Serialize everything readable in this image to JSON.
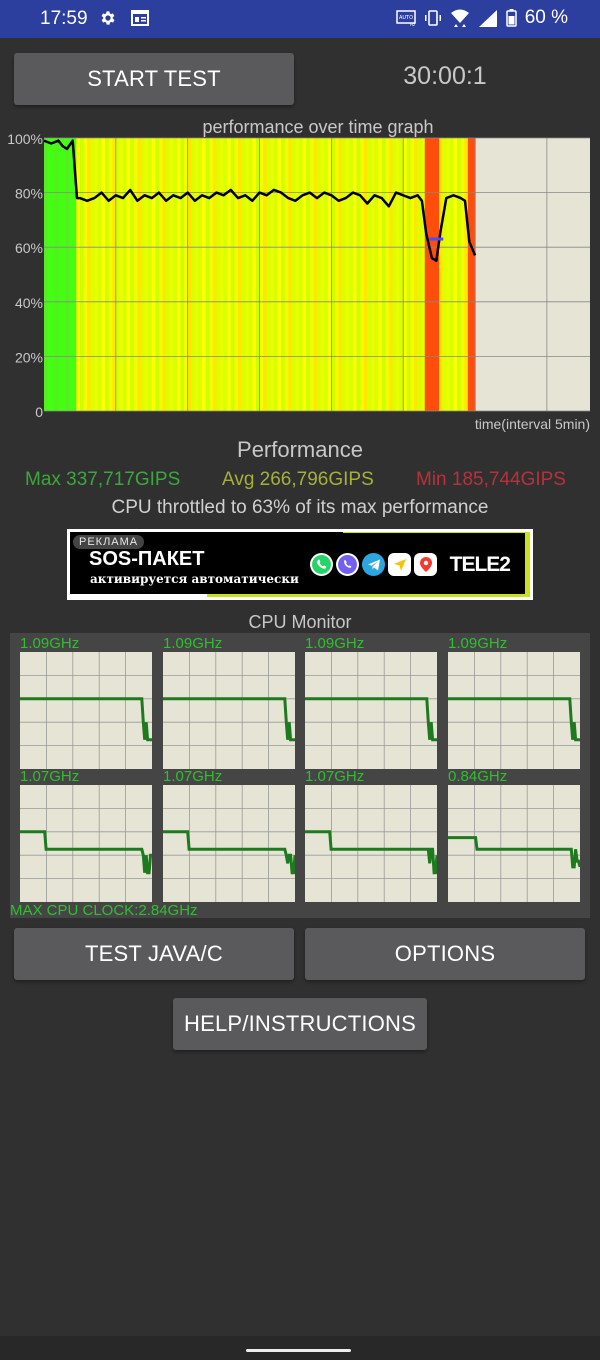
{
  "status_bar": {
    "time": "17:59",
    "battery_text": "60 %",
    "left_icons": [
      "gear-icon",
      "calendar-icon"
    ],
    "right_icons": [
      "auto-hz-icon",
      "vibrate-icon",
      "wifi-icon",
      "signal-icon",
      "battery-icon"
    ]
  },
  "controls": {
    "start_label": "START TEST",
    "timer": "30:00:1"
  },
  "chart_title": "performance over time graph",
  "chart_data": {
    "type": "area",
    "title": "performance over time graph",
    "xlabel": "time(interval 5min)",
    "ylabel": "",
    "ytick_labels": [
      "0",
      "20%",
      "40%",
      "60%",
      "80%",
      "100%"
    ],
    "yticks": [
      0,
      20,
      40,
      60,
      80,
      100
    ],
    "ylim": [
      0,
      100
    ],
    "xlim": [
      0,
      38
    ],
    "x_grid_interval": 5,
    "grid": true,
    "x": [
      0,
      0.5,
      1,
      1.3,
      1.6,
      2.0,
      2.3,
      2.5,
      3.0,
      3.5,
      4.0,
      4.5,
      5.0,
      5.5,
      6.0,
      6.5,
      7.0,
      7.5,
      8.0,
      8.5,
      9.0,
      9.5,
      10.0,
      10.5,
      11.0,
      11.5,
      12.0,
      12.5,
      13.0,
      13.5,
      14.0,
      14.5,
      15.0,
      15.5,
      16.0,
      16.5,
      17.0,
      17.5,
      18.0,
      18.5,
      19.0,
      19.5,
      20.0,
      20.5,
      21.0,
      21.5,
      22.0,
      22.5,
      23.0,
      23.5,
      24.0,
      24.5,
      25.0,
      25.5,
      26.0,
      26.3,
      26.6,
      27.0,
      27.3,
      27.6,
      28.0,
      28.5,
      29.0,
      29.3,
      29.6,
      30.0
    ],
    "values": [
      99,
      98,
      99,
      97,
      96,
      99,
      78,
      78,
      77,
      78,
      80,
      77,
      79,
      78,
      81,
      77,
      79,
      78,
      80,
      77,
      79,
      78,
      80,
      77,
      79,
      78,
      80,
      79,
      81,
      78,
      79,
      77,
      80,
      79,
      81,
      80,
      78,
      77,
      79,
      80,
      78,
      80,
      79,
      77,
      78,
      80,
      79,
      76,
      79,
      78,
      75,
      80,
      79,
      78,
      79,
      77,
      65,
      56,
      55,
      66,
      78,
      79,
      78,
      77,
      62,
      57
    ],
    "bar_colors": "green before throttle, yellow/lime while throttled, red-orange where performance dropped sharply",
    "markers": [
      {
        "x": 27.3,
        "y": 63,
        "color": "#4a4aff",
        "label": "throttle line"
      }
    ]
  },
  "performance": {
    "heading": "Performance",
    "max": "Max 337,717GIPS",
    "avg": "Avg 266,796GIPS",
    "min": "Min 185,744GIPS",
    "throttle_text": "CPU throttled to 63% of its max performance",
    "colors": {
      "max": "#3aa83a",
      "avg": "#a4b03a",
      "min": "#b8303c"
    }
  },
  "ad": {
    "label": "РЕКЛАМА",
    "title": "SOS-ПАКЕТ",
    "subtitle": "активируется автоматически",
    "brand": "TELE2",
    "app_icons": [
      "whatsapp-icon",
      "viber-icon",
      "telegram-icon",
      "navigator-icon",
      "maps-pin-icon"
    ],
    "accent": "#c6e31b"
  },
  "cpu_monitor": {
    "title": "CPU Monitor",
    "cores": [
      {
        "freq": "1.09GHz",
        "trace": [
          0.6,
          0.6,
          0.6,
          0.6,
          0.6,
          0.6,
          0.6,
          0.6,
          0.6,
          0.6,
          0.6,
          0.6,
          0.6,
          0.6,
          0.6,
          0.6,
          0.6,
          0.6,
          0.6,
          0.6,
          0.6,
          0.6,
          0.6,
          0.6,
          0.6,
          0.6,
          0.6,
          0.6,
          0.6,
          0.6,
          0.6,
          0.6,
          0.6,
          0.6,
          0.6,
          0.6,
          0.6,
          0.6,
          0.6,
          0.6,
          0.6,
          0.6,
          0.6,
          0.6,
          0.6,
          0.6,
          0.6,
          0.6,
          0.6,
          0.6,
          0.6,
          0.6,
          0.6,
          0.6,
          0.6,
          0.6,
          0.6,
          0.6,
          0.6,
          0.6,
          0.6,
          0.6,
          0.6,
          0.6,
          0.6,
          0.6,
          0.6,
          0.6,
          0.6,
          0.6,
          0.6,
          0.6,
          0.6,
          0.6,
          0.6,
          0.6,
          0.6,
          0.6,
          0.6,
          0.6,
          0.6,
          0.6,
          0.6,
          0.6,
          0.6,
          0.4,
          0.25,
          0.4,
          0.25,
          0.25,
          0.25,
          0.25
        ]
      },
      {
        "freq": "1.09GHz",
        "trace": [
          0.6,
          0.6,
          0.6,
          0.6,
          0.6,
          0.6,
          0.6,
          0.6,
          0.6,
          0.6,
          0.6,
          0.6,
          0.6,
          0.6,
          0.6,
          0.6,
          0.6,
          0.6,
          0.6,
          0.6,
          0.6,
          0.6,
          0.6,
          0.6,
          0.6,
          0.6,
          0.6,
          0.6,
          0.6,
          0.6,
          0.6,
          0.6,
          0.6,
          0.6,
          0.6,
          0.6,
          0.6,
          0.6,
          0.6,
          0.6,
          0.6,
          0.6,
          0.6,
          0.6,
          0.6,
          0.6,
          0.6,
          0.6,
          0.6,
          0.6,
          0.6,
          0.6,
          0.6,
          0.6,
          0.6,
          0.6,
          0.6,
          0.6,
          0.6,
          0.6,
          0.6,
          0.6,
          0.6,
          0.6,
          0.6,
          0.6,
          0.6,
          0.6,
          0.6,
          0.6,
          0.6,
          0.6,
          0.6,
          0.6,
          0.6,
          0.6,
          0.6,
          0.6,
          0.6,
          0.6,
          0.6,
          0.6,
          0.6,
          0.6,
          0.6,
          0.4,
          0.25,
          0.4,
          0.25,
          0.25,
          0.25,
          0.25
        ]
      },
      {
        "freq": "1.09GHz",
        "trace": [
          0.6,
          0.6,
          0.6,
          0.6,
          0.6,
          0.6,
          0.6,
          0.6,
          0.6,
          0.6,
          0.6,
          0.6,
          0.6,
          0.6,
          0.6,
          0.6,
          0.6,
          0.6,
          0.6,
          0.6,
          0.6,
          0.6,
          0.6,
          0.6,
          0.6,
          0.6,
          0.6,
          0.6,
          0.6,
          0.6,
          0.6,
          0.6,
          0.6,
          0.6,
          0.6,
          0.6,
          0.6,
          0.6,
          0.6,
          0.6,
          0.6,
          0.6,
          0.6,
          0.6,
          0.6,
          0.6,
          0.6,
          0.6,
          0.6,
          0.6,
          0.6,
          0.6,
          0.6,
          0.6,
          0.6,
          0.6,
          0.6,
          0.6,
          0.6,
          0.6,
          0.6,
          0.6,
          0.6,
          0.6,
          0.6,
          0.6,
          0.6,
          0.6,
          0.6,
          0.6,
          0.6,
          0.6,
          0.6,
          0.6,
          0.6,
          0.6,
          0.6,
          0.6,
          0.6,
          0.6,
          0.6,
          0.6,
          0.6,
          0.6,
          0.6,
          0.4,
          0.25,
          0.4,
          0.25,
          0.25,
          0.25,
          0.25
        ]
      },
      {
        "freq": "1.09GHz",
        "trace": [
          0.6,
          0.6,
          0.6,
          0.6,
          0.6,
          0.6,
          0.6,
          0.6,
          0.6,
          0.6,
          0.6,
          0.6,
          0.6,
          0.6,
          0.6,
          0.6,
          0.6,
          0.6,
          0.6,
          0.6,
          0.6,
          0.6,
          0.6,
          0.6,
          0.6,
          0.6,
          0.6,
          0.6,
          0.6,
          0.6,
          0.6,
          0.6,
          0.6,
          0.6,
          0.6,
          0.6,
          0.6,
          0.6,
          0.6,
          0.6,
          0.6,
          0.6,
          0.6,
          0.6,
          0.6,
          0.6,
          0.6,
          0.6,
          0.6,
          0.6,
          0.6,
          0.6,
          0.6,
          0.6,
          0.6,
          0.6,
          0.6,
          0.6,
          0.6,
          0.6,
          0.6,
          0.6,
          0.6,
          0.6,
          0.6,
          0.6,
          0.6,
          0.6,
          0.6,
          0.6,
          0.6,
          0.6,
          0.6,
          0.6,
          0.6,
          0.6,
          0.6,
          0.6,
          0.6,
          0.6,
          0.6,
          0.6,
          0.6,
          0.6,
          0.6,
          0.4,
          0.25,
          0.4,
          0.25,
          0.25,
          0.25,
          0.25
        ]
      },
      {
        "freq": "1.07GHz",
        "trace": [
          0.6,
          0.6,
          0.6,
          0.6,
          0.6,
          0.6,
          0.6,
          0.6,
          0.6,
          0.6,
          0.6,
          0.6,
          0.6,
          0.6,
          0.6,
          0.6,
          0.6,
          0.6,
          0.45,
          0.45,
          0.45,
          0.45,
          0.45,
          0.45,
          0.45,
          0.45,
          0.45,
          0.45,
          0.45,
          0.45,
          0.45,
          0.45,
          0.45,
          0.45,
          0.45,
          0.45,
          0.45,
          0.45,
          0.45,
          0.45,
          0.45,
          0.45,
          0.45,
          0.45,
          0.45,
          0.45,
          0.45,
          0.45,
          0.45,
          0.45,
          0.45,
          0.45,
          0.45,
          0.45,
          0.45,
          0.45,
          0.45,
          0.45,
          0.45,
          0.45,
          0.45,
          0.45,
          0.45,
          0.45,
          0.45,
          0.45,
          0.45,
          0.45,
          0.45,
          0.45,
          0.45,
          0.45,
          0.45,
          0.45,
          0.45,
          0.45,
          0.45,
          0.45,
          0.45,
          0.45,
          0.45,
          0.45,
          0.45,
          0.45,
          0.45,
          0.4,
          0.25,
          0.4,
          0.25,
          0.25,
          0.4,
          0.4
        ]
      },
      {
        "freq": "1.07GHz",
        "trace": [
          0.6,
          0.6,
          0.6,
          0.6,
          0.6,
          0.6,
          0.6,
          0.6,
          0.6,
          0.6,
          0.6,
          0.6,
          0.6,
          0.6,
          0.6,
          0.6,
          0.6,
          0.6,
          0.45,
          0.45,
          0.45,
          0.45,
          0.45,
          0.45,
          0.45,
          0.45,
          0.45,
          0.45,
          0.45,
          0.45,
          0.45,
          0.45,
          0.45,
          0.45,
          0.45,
          0.45,
          0.45,
          0.45,
          0.45,
          0.45,
          0.45,
          0.45,
          0.45,
          0.45,
          0.45,
          0.45,
          0.45,
          0.45,
          0.45,
          0.45,
          0.45,
          0.45,
          0.45,
          0.45,
          0.45,
          0.45,
          0.45,
          0.45,
          0.45,
          0.45,
          0.45,
          0.45,
          0.45,
          0.45,
          0.45,
          0.45,
          0.45,
          0.45,
          0.45,
          0.45,
          0.45,
          0.45,
          0.45,
          0.45,
          0.45,
          0.45,
          0.45,
          0.45,
          0.45,
          0.45,
          0.45,
          0.45,
          0.45,
          0.45,
          0.45,
          0.4,
          0.33,
          0.4,
          0.4,
          0.25,
          0.25,
          0.4
        ]
      },
      {
        "freq": "1.07GHz",
        "trace": [
          0.6,
          0.6,
          0.6,
          0.6,
          0.6,
          0.6,
          0.6,
          0.6,
          0.6,
          0.6,
          0.6,
          0.6,
          0.6,
          0.6,
          0.6,
          0.6,
          0.6,
          0.6,
          0.45,
          0.45,
          0.45,
          0.45,
          0.45,
          0.45,
          0.45,
          0.45,
          0.45,
          0.45,
          0.45,
          0.45,
          0.45,
          0.45,
          0.45,
          0.45,
          0.45,
          0.45,
          0.45,
          0.45,
          0.45,
          0.45,
          0.45,
          0.45,
          0.45,
          0.45,
          0.45,
          0.45,
          0.45,
          0.45,
          0.45,
          0.45,
          0.45,
          0.45,
          0.45,
          0.45,
          0.45,
          0.45,
          0.45,
          0.45,
          0.45,
          0.45,
          0.45,
          0.45,
          0.45,
          0.45,
          0.45,
          0.45,
          0.45,
          0.45,
          0.45,
          0.45,
          0.45,
          0.45,
          0.45,
          0.45,
          0.45,
          0.45,
          0.45,
          0.45,
          0.45,
          0.45,
          0.45,
          0.45,
          0.45,
          0.45,
          0.45,
          0.45,
          0.33,
          0.45,
          0.45,
          0.25,
          0.25,
          0.4
        ]
      },
      {
        "freq": "0.84GHz",
        "trace": [
          0.55,
          0.55,
          0.55,
          0.55,
          0.55,
          0.55,
          0.55,
          0.55,
          0.55,
          0.55,
          0.55,
          0.55,
          0.55,
          0.55,
          0.55,
          0.55,
          0.55,
          0.55,
          0.55,
          0.55,
          0.45,
          0.45,
          0.45,
          0.45,
          0.45,
          0.45,
          0.45,
          0.45,
          0.45,
          0.45,
          0.45,
          0.45,
          0.45,
          0.45,
          0.45,
          0.45,
          0.45,
          0.45,
          0.45,
          0.45,
          0.45,
          0.45,
          0.45,
          0.45,
          0.45,
          0.45,
          0.45,
          0.45,
          0.45,
          0.45,
          0.45,
          0.45,
          0.45,
          0.45,
          0.45,
          0.45,
          0.45,
          0.45,
          0.45,
          0.45,
          0.45,
          0.45,
          0.45,
          0.45,
          0.45,
          0.45,
          0.45,
          0.45,
          0.45,
          0.45,
          0.45,
          0.45,
          0.45,
          0.45,
          0.45,
          0.45,
          0.45,
          0.45,
          0.45,
          0.45,
          0.45,
          0.45,
          0.45,
          0.45,
          0.45,
          0.45,
          0.3,
          0.3,
          0.45,
          0.35,
          0.35,
          0.3
        ]
      }
    ],
    "max_clock": "MAX CPU CLOCK:2.84GHz",
    "trace_color": "#1e7a1e"
  },
  "buttons": {
    "test_javac": "TEST JAVA/C",
    "options": "OPTIONS",
    "help": "HELP/INSTRUCTIONS"
  }
}
